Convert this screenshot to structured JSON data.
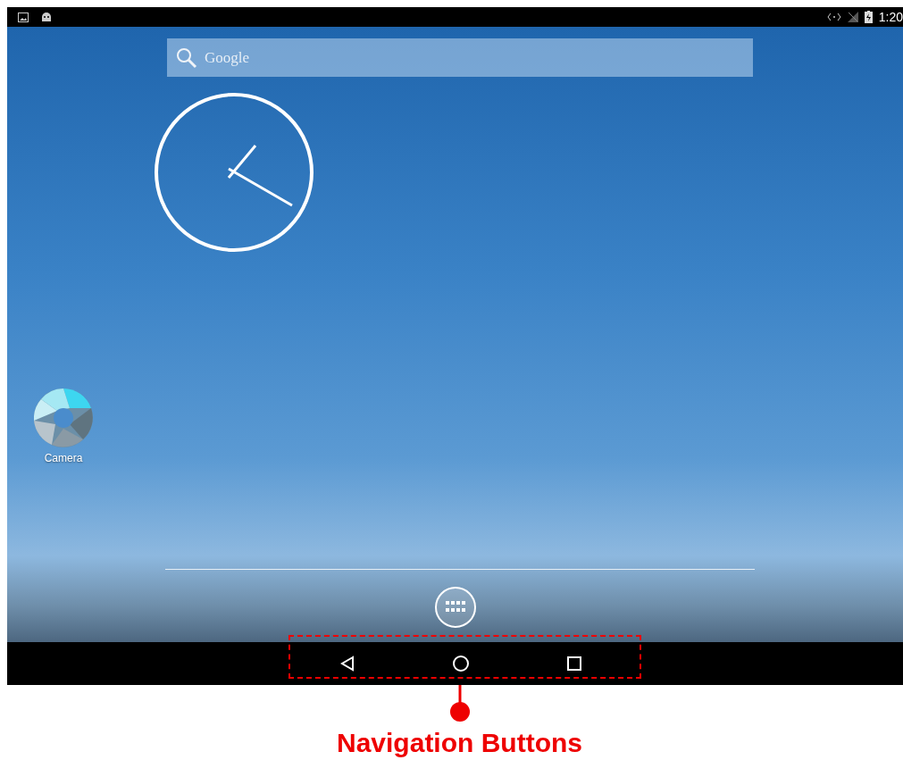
{
  "status_bar": {
    "time": "1:20"
  },
  "search": {
    "placeholder": "Google"
  },
  "apps": [
    {
      "label": "Camera"
    }
  ],
  "annotation": {
    "label": "Navigation Buttons"
  }
}
